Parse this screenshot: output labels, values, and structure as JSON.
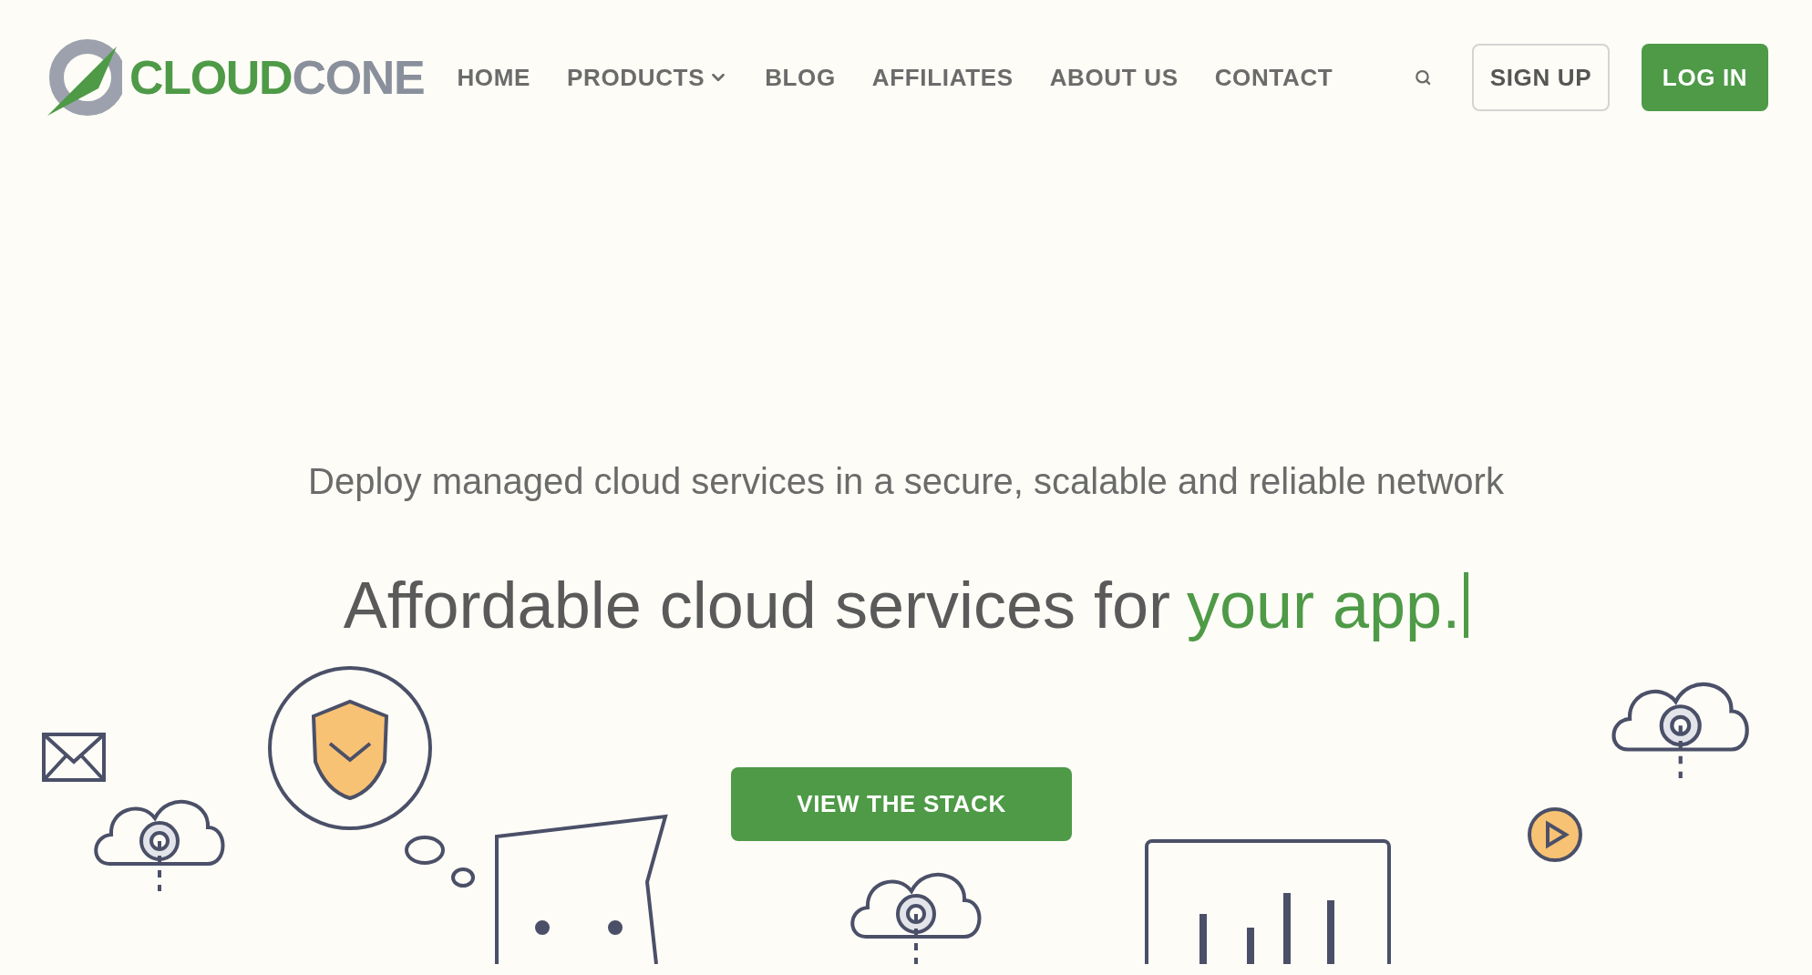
{
  "logo": {
    "part_1": "CLOUD",
    "part_2": "CONE"
  },
  "nav": [
    {
      "label": "HOME",
      "dropdown": false
    },
    {
      "label": "PRODUCTS",
      "dropdown": true
    },
    {
      "label": "BLOG",
      "dropdown": false
    },
    {
      "label": "AFFILIATES",
      "dropdown": false
    },
    {
      "label": "ABOUT US",
      "dropdown": false
    },
    {
      "label": "CONTACT",
      "dropdown": false
    }
  ],
  "buttons": {
    "sign_up": "SIGN UP",
    "log_in": "LOG IN"
  },
  "hero": {
    "subtitle": "Deploy managed cloud services in a secure, scalable and reliable network",
    "headline": "Affordable cloud services for",
    "highlight": "your app.",
    "caret": true,
    "cta": "VIEW THE STACK"
  }
}
